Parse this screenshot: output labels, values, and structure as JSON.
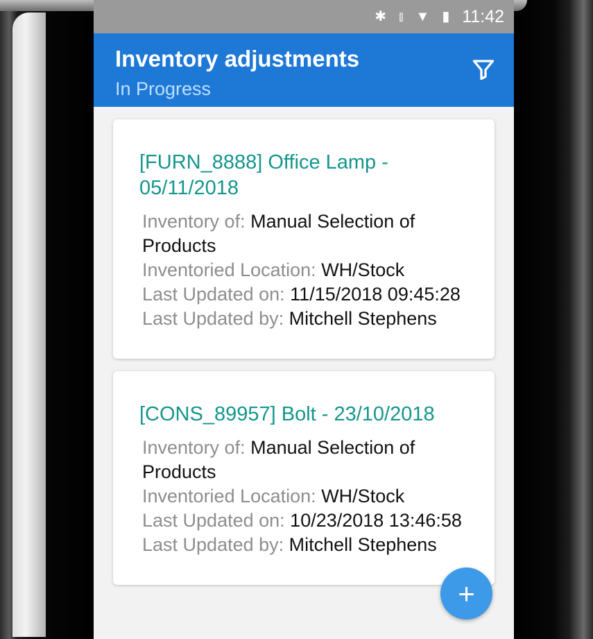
{
  "status": {
    "time": "11:42",
    "icons": [
      "bluetooth-icon",
      "vibrate-icon",
      "wifi-icon",
      "battery-icon"
    ]
  },
  "appbar": {
    "title": "Inventory adjustments",
    "subtitle": "In Progress"
  },
  "labels": {
    "inventory_of": "Inventory of:",
    "location": "Inventoried Location:",
    "updated_on": "Last Updated on:",
    "updated_by": "Last Updated by:"
  },
  "cards": [
    {
      "name": "[FURN_8888] Office Lamp - 05/11/2018",
      "inventory_of": "Manual Selection of Products",
      "location": "WH/Stock",
      "updated_on": "11/15/2018 09:45:28",
      "updated_by": "Mitchell Stephens"
    },
    {
      "name": "[CONS_89957] Bolt - 23/10/2018",
      "inventory_of": "Manual Selection of Products",
      "location": "WH/Stock",
      "updated_on": "10/23/2018 13:46:58",
      "updated_by": "Mitchell Stephens"
    }
  ],
  "fab": {
    "label": "+"
  },
  "colors": {
    "appbar": "#1e78d6",
    "item_title": "#13968b",
    "fab": "#3d9ae8"
  }
}
